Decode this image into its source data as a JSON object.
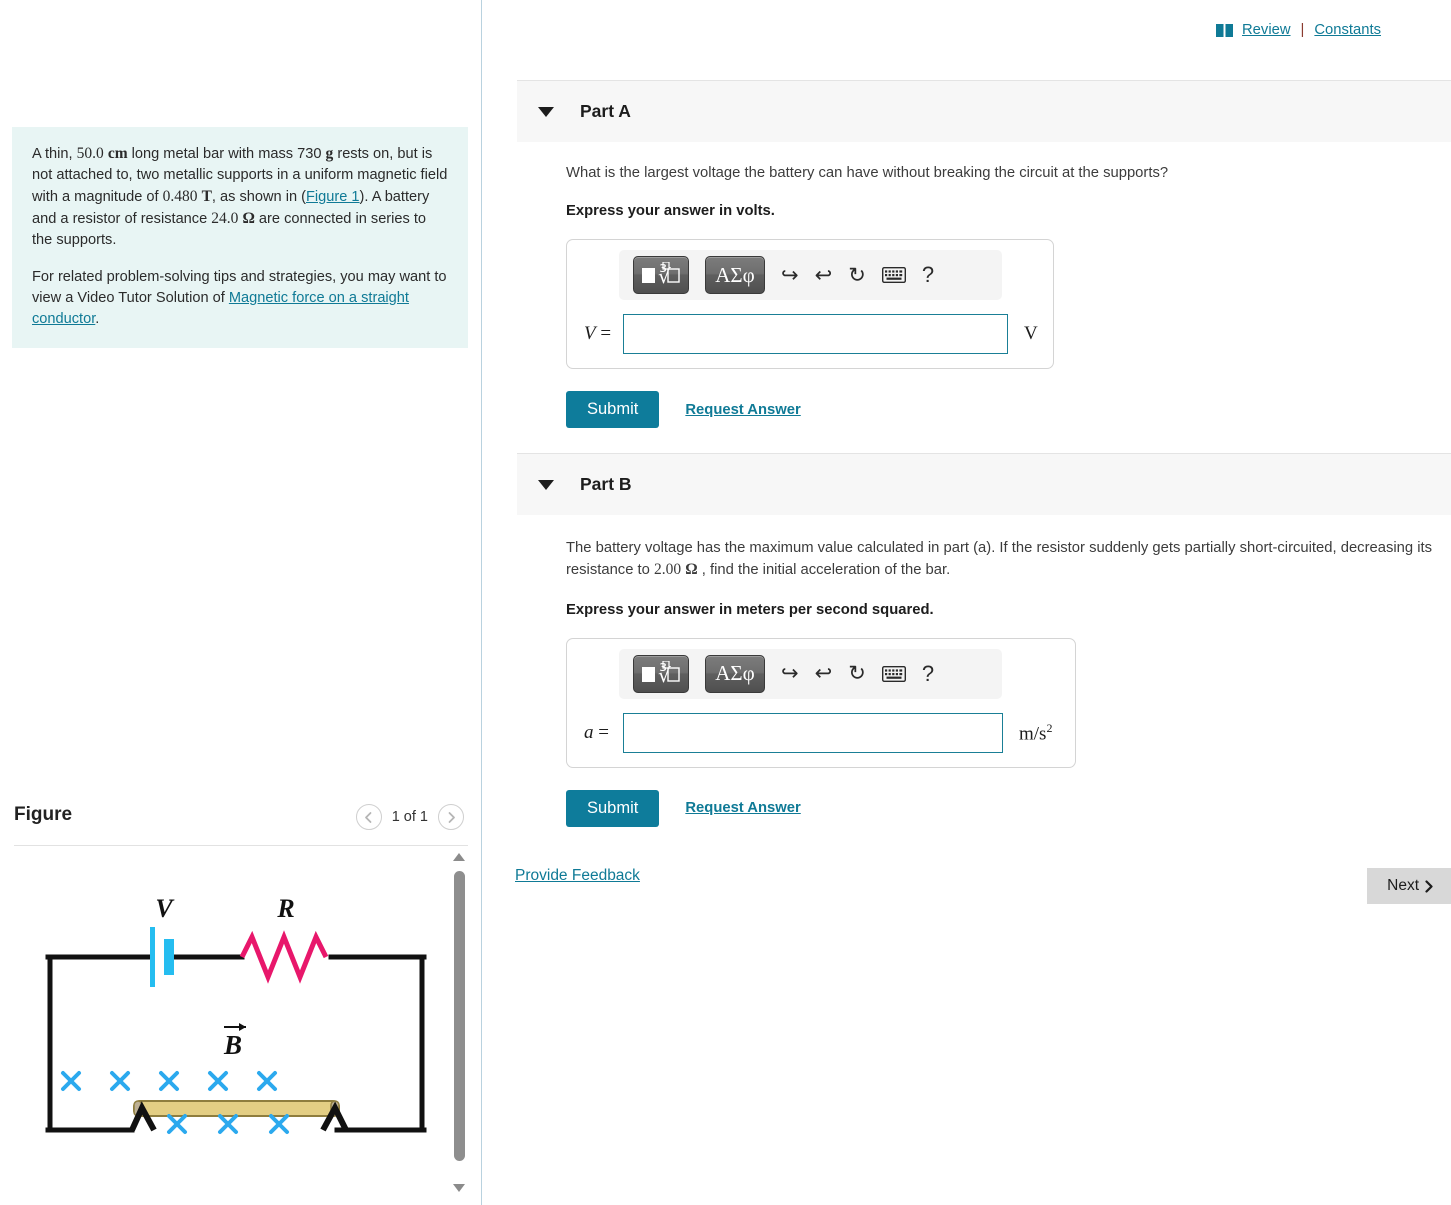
{
  "header": {
    "book_icon": "book-icon",
    "review_label": "Review",
    "separator": "|",
    "constants_label": "Constants"
  },
  "problem": {
    "line1_a": "A thin, ",
    "line1_len": "50.0",
    "line1_len_unit": "cm",
    "line1_b": " long metal bar with mass 730 ",
    "line1_mass_unit": "g",
    "line1_c": " rests on, but is not attached to, two metallic supports in a uniform magnetic field with a magnitude of ",
    "field_value": "0.480",
    "field_unit": "T",
    "line1_d": ", as shown in (",
    "figure_link": "Figure 1",
    "line1_e": "). A battery and a resistor of resistance ",
    "resistance_value": "24.0",
    "resistance_unit": "Ω",
    "line1_f": " are connected in series to the supports.",
    "para2_a": "For related problem-solving tips and strategies, you may want to view a Video Tutor Solution of ",
    "tutor_link": "Magnetic force on a straight conductor",
    "para2_b": "."
  },
  "figure": {
    "title": "Figure",
    "counter": "1 of 1",
    "prev_icon": "chevron-left-icon",
    "next_icon": "chevron-right-icon",
    "labels": {
      "battery": "V",
      "resistor": "R",
      "field": "B"
    },
    "colors": {
      "wire": "#111111",
      "battery": "#25BDF0",
      "resistor": "#E8176B",
      "field_x": "#2BA9EE",
      "bar_fill": "#E3CE84",
      "bar_stroke": "#8e7d3e"
    },
    "field_x_rows": {
      "top_count": 5,
      "bottom_count": 3
    }
  },
  "parts": [
    {
      "id": "part-a",
      "label": "Part A",
      "caret_icon": "caret-down-icon",
      "question": "What is the largest voltage the battery can have without breaking the circuit at the supports?",
      "instruction": "Express your answer in volts.",
      "variable": "V",
      "equals": "=",
      "input_value": "",
      "unit": "V",
      "unit_sup": "",
      "submit_label": "Submit",
      "request_label": "Request Answer"
    },
    {
      "id": "part-b",
      "label": "Part B",
      "caret_icon": "caret-down-icon",
      "question_a": "The battery voltage has the maximum value calculated in part (a). If the resistor suddenly gets partially short-circuited, decreasing its resistance to ",
      "question_value": "2.00",
      "question_unit": "Ω",
      "question_b": " , find the initial acceleration of the bar.",
      "instruction": "Express your answer in meters per second squared.",
      "variable": "a",
      "equals": "=",
      "input_value": "",
      "unit": "m/s",
      "unit_sup": "2",
      "submit_label": "Submit",
      "request_label": "Request Answer"
    }
  ],
  "mathbar": {
    "template_btn": "math-template-button",
    "greek_btn": "ΑΣφ",
    "undo_icon": "undo-arrow-icon",
    "redo_icon": "redo-arrow-icon",
    "reset_icon": "reset-circle-icon",
    "keyboard_icon": "keyboard-icon",
    "help_label": "?"
  },
  "footer": {
    "feedback_label": "Provide Feedback",
    "next_label": "Next",
    "next_icon": "chevron-right-icon"
  },
  "colors": {
    "link": "#0f7a96",
    "accent": "#0e7c9b",
    "problem_bg": "#e8f5f4",
    "part_header_bg": "#f7f7f7"
  }
}
